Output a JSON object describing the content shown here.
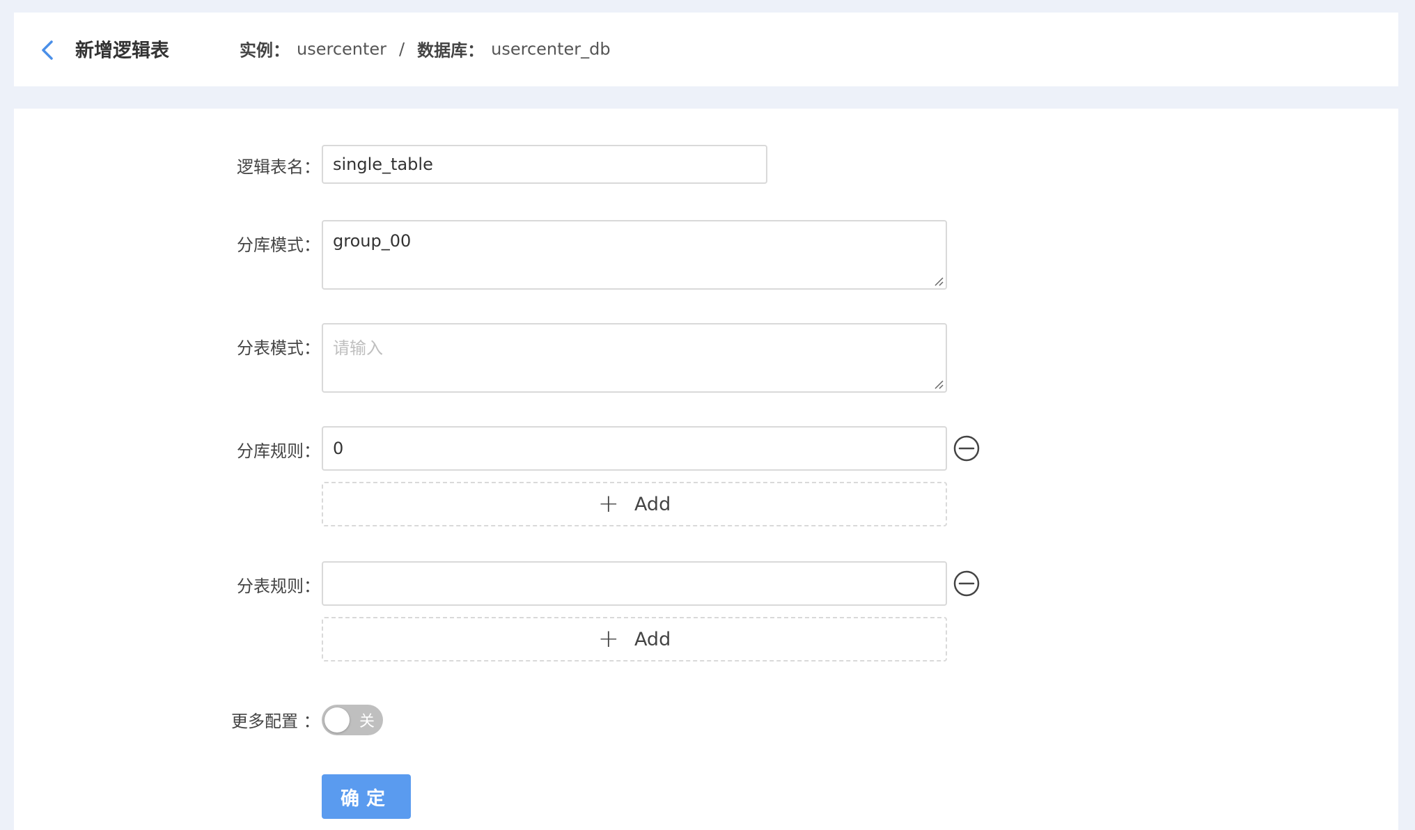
{
  "header": {
    "title": "新增逻辑表",
    "instance_label": "实例：",
    "instance_value": "usercenter",
    "separator": "/",
    "database_label": "数据库：",
    "database_value": "usercenter_db"
  },
  "form": {
    "logical_table_name": {
      "label": "逻辑表名：",
      "value": "single_table"
    },
    "db_pattern": {
      "label": "分库模式：",
      "value": "group_00"
    },
    "table_pattern": {
      "label": "分表模式：",
      "value": "",
      "placeholder": "请输入"
    },
    "db_rule": {
      "label": "分库规则：",
      "value": "0",
      "add_label": "Add"
    },
    "table_rule": {
      "label": "分表规则：",
      "value": "",
      "add_label": "Add"
    },
    "more_config": {
      "label": "更多配置 ：",
      "switch_text": "关",
      "enabled": false
    },
    "submit_label": "确定"
  },
  "colors": {
    "accent": "#5a9bef",
    "back_icon": "#4a8fe8",
    "page_bg": "#edf1f9",
    "switch_off": "#bfbfbf"
  },
  "icons": {
    "back": "chevron-left-icon",
    "remove": "minus-circle-icon",
    "add": "plus-icon"
  }
}
